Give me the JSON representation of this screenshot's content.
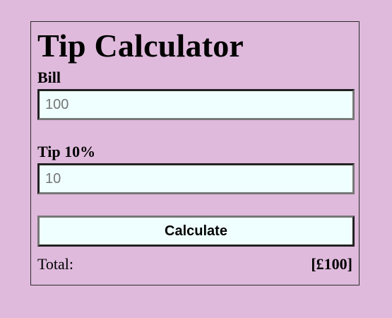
{
  "app": {
    "title": "Tip Calculator"
  },
  "form": {
    "bill_label": "Bill",
    "bill_placeholder": "100",
    "tip_label": "Tip 10%",
    "tip_placeholder": "10",
    "calculate_label": "Calculate"
  },
  "result": {
    "total_label": "Total:",
    "total_value": "[£100]"
  },
  "colors": {
    "background": "#dfbadc",
    "input_background": "#efffff"
  }
}
